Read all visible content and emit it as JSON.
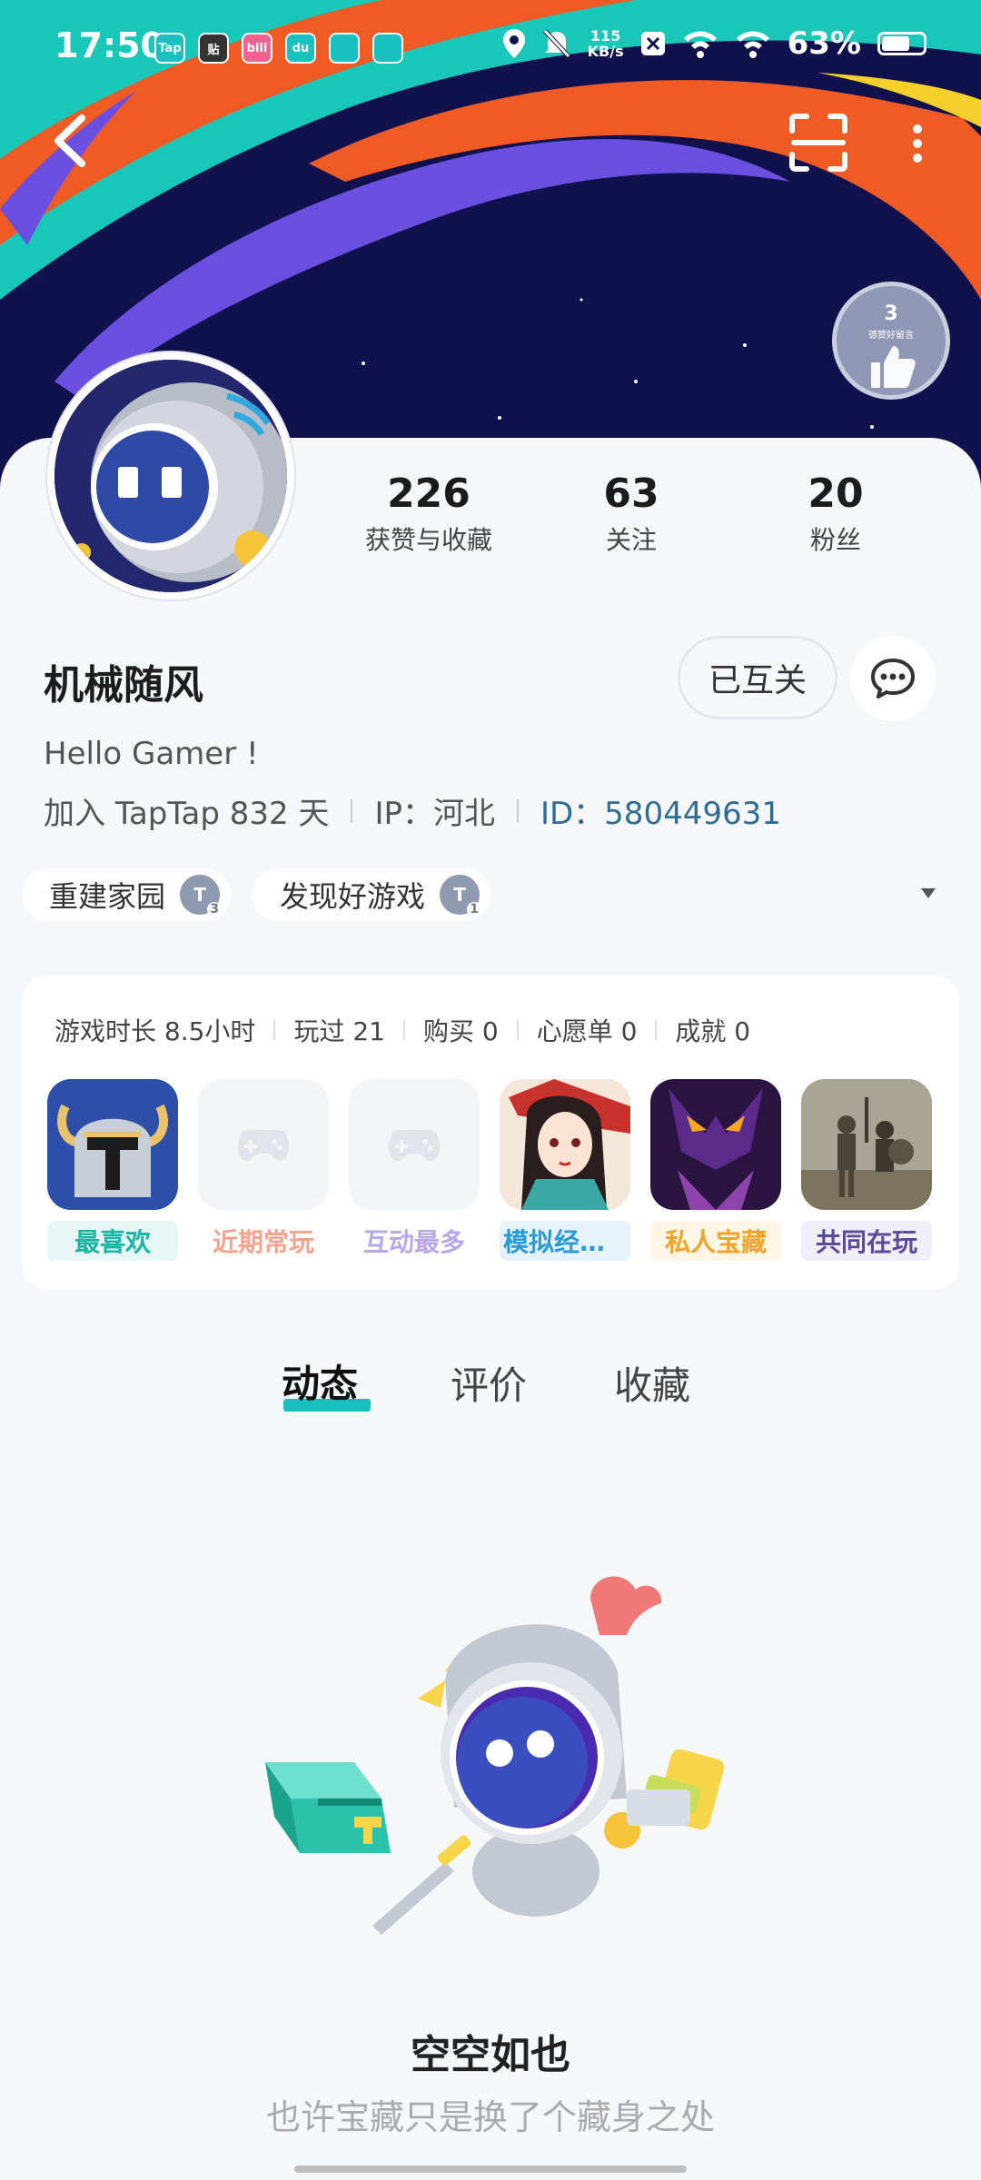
{
  "status_bar": {
    "time": "17:50",
    "app_icons": [
      {
        "name": "taptap-icon",
        "label": "Tap",
        "color": "#18c0bf"
      },
      {
        "name": "tieba-icon",
        "label": "贴",
        "color": "#333333"
      },
      {
        "name": "bilibili-icon",
        "label": "bili",
        "color": "#f06292"
      },
      {
        "name": "notification-icon",
        "label": "du",
        "color": "#18c0bf"
      },
      {
        "name": "gallery-icon",
        "label": "",
        "color": "#18c0bf"
      },
      {
        "name": "browser-icon",
        "label": "",
        "color": "#18c0bf"
      }
    ],
    "net_speed_value": "115",
    "net_speed_unit": "KB/s",
    "battery": "63%"
  },
  "header": {
    "medal_level": "3",
    "medal_sub": "德赞好留言"
  },
  "profile": {
    "stats": [
      {
        "value": "226",
        "label": "获赞与收藏"
      },
      {
        "value": "63",
        "label": "关注"
      },
      {
        "value": "20",
        "label": "粉丝"
      }
    ],
    "username": "机械随风",
    "follow_status": "已互关",
    "bio": "Hello Gamer !",
    "joined": "加入 TapTap 832 天",
    "ip": "IP：河北",
    "user_id": "ID：580449631",
    "tags": [
      {
        "label": "重建家园",
        "badge": "T",
        "level": "3"
      },
      {
        "label": "发现好游戏",
        "badge": "T",
        "level": "1"
      }
    ]
  },
  "games_panel": {
    "stats": [
      "游戏时长 8.5小时",
      "玩过 21",
      "购买 0",
      "心愿单 0",
      "成就 0"
    ],
    "items": [
      {
        "label": "最喜欢",
        "color": "#18b5a4",
        "bg": "#e6f7f5"
      },
      {
        "label": "近期常玩",
        "color": "#f4a48e",
        "bg": "#ffffff"
      },
      {
        "label": "互动最多",
        "color": "#b6a8e8",
        "bg": "#ffffff"
      },
      {
        "label": "模拟经营…",
        "color": "#2a9bd8",
        "bg": "#e6f3fb"
      },
      {
        "label": "私人宝藏",
        "color": "#f2a32c",
        "bg": "#fff6e6"
      },
      {
        "label": "共同在玩",
        "color": "#5a4a9a",
        "bg": "#f0eef8"
      }
    ]
  },
  "tabs": [
    {
      "label": "动态",
      "active": true
    },
    {
      "label": "评价",
      "active": false
    },
    {
      "label": "收藏",
      "active": false
    }
  ],
  "empty_state": {
    "title": "空空如也",
    "subtitle": "也许宝藏只是换了个藏身之处"
  }
}
